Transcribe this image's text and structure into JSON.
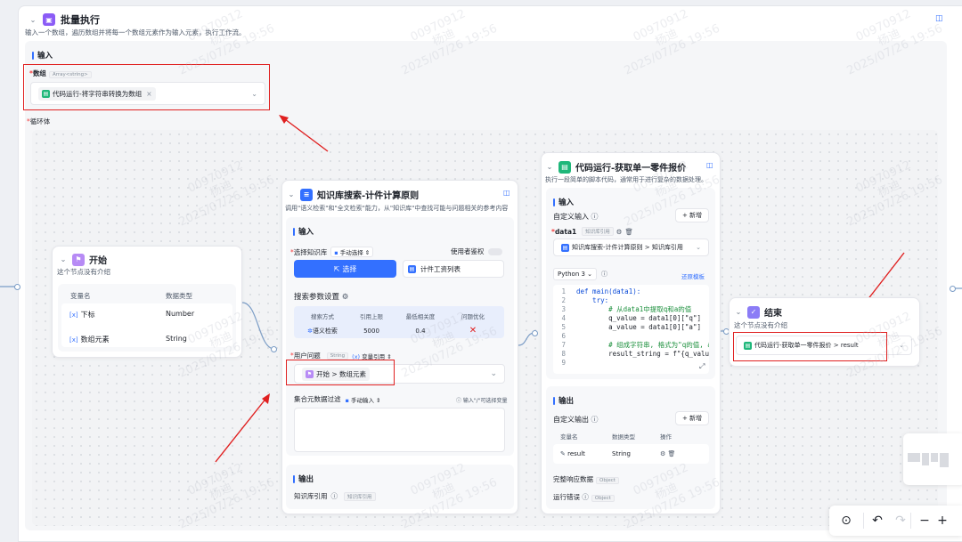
{
  "batch": {
    "title": "批量执行",
    "description": "输入一个数组，遍历数组并将每一个数组元素作为输入元素，执行工作流。",
    "input_section": "输入",
    "array_field_label": "数组",
    "array_field_type": "Array<string>",
    "array_value": "代码运行-将字符串转换为数组",
    "loop_label": "循环体"
  },
  "start_node": {
    "title": "开始",
    "description": "这个节点没有介绍",
    "col_name": "变量名",
    "col_type": "数据类型",
    "rows": [
      {
        "name": "下标",
        "type": "Number"
      },
      {
        "name": "数组元素",
        "type": "String"
      }
    ]
  },
  "kb_node": {
    "title": "知识库搜索-计件计算原则",
    "description": "调用\"语义检索\"和\"全文检索\"能力，从\"知识库\"中查找可能与问题相关的参考内容",
    "input_section": "输入",
    "select_kb_label": "选择知识库",
    "manual_select": "手动选择",
    "use_auth": "使用者鉴权",
    "select_button": "选择",
    "kb_item": "计件工资列表",
    "search_params": "搜索参数设置",
    "params_headers": [
      "搜索方式",
      "引用上限",
      "最低相关度",
      "问题优化"
    ],
    "params_values": [
      "语义检索",
      "5000",
      "0.4"
    ],
    "user_question_label": "用户问题",
    "user_question_type": "String",
    "var_ref": "变量引用",
    "user_question_value": "开始 > 数组元素",
    "filter_label": "集合元数据过滤",
    "manual_input": "手动输入",
    "filter_hint": "输入\"/\"可选择变量",
    "output_section": "输出",
    "kb_ref": "知识库引用",
    "kb_ref_type": "知识库引用"
  },
  "code_node": {
    "title": "代码运行-获取单一零件报价",
    "description": "执行一段简单的脚本代码，通常用于进行复杂的数据处理。",
    "input_section": "输入",
    "custom_input": "自定义输入",
    "add_button": "+ 新增",
    "var_name": "data1",
    "var_type": "知识库引用",
    "var_value": "知识库搜索-计件计算原则 > 知识库引用",
    "lang": "Python 3",
    "restore": "还原模板",
    "code_lines": [
      {
        "n": "1",
        "text": "def main(data1):"
      },
      {
        "n": "2",
        "text": "    try:"
      },
      {
        "n": "3",
        "text": "        # 从data1中提取q和a的值"
      },
      {
        "n": "4",
        "text": "        q_value = data1[0][\"q\"]"
      },
      {
        "n": "5",
        "text": "        a_value = data1[0][\"a\"]"
      },
      {
        "n": "6",
        "text": ""
      },
      {
        "n": "7",
        "text": "        # 组成字符串, 格式为\"q的值, a的"
      },
      {
        "n": "8",
        "text": "        result_string = f\"{q_value"
      },
      {
        "n": "9",
        "text": ""
      }
    ],
    "output_section": "输出",
    "custom_output": "自定义输出",
    "out_col_name": "变量名",
    "out_col_type": "数据类型",
    "out_col_op": "操作",
    "out_row_name": "result",
    "out_row_type": "String",
    "full_response": "完整响应数据",
    "full_response_type": "Object",
    "run_error": "运行错误",
    "run_error_type": "Object"
  },
  "end_node": {
    "title": "结束",
    "description": "这个节点没有介绍",
    "value": "代码运行-获取单一零件报价 > result"
  },
  "watermark": {
    "id": "00970912",
    "name": "杨迪",
    "time": "2025/07/26 19:56"
  },
  "colors": {
    "accent": "#3370ff",
    "highlight_box": "#e02020",
    "arrow": "#e02020"
  }
}
